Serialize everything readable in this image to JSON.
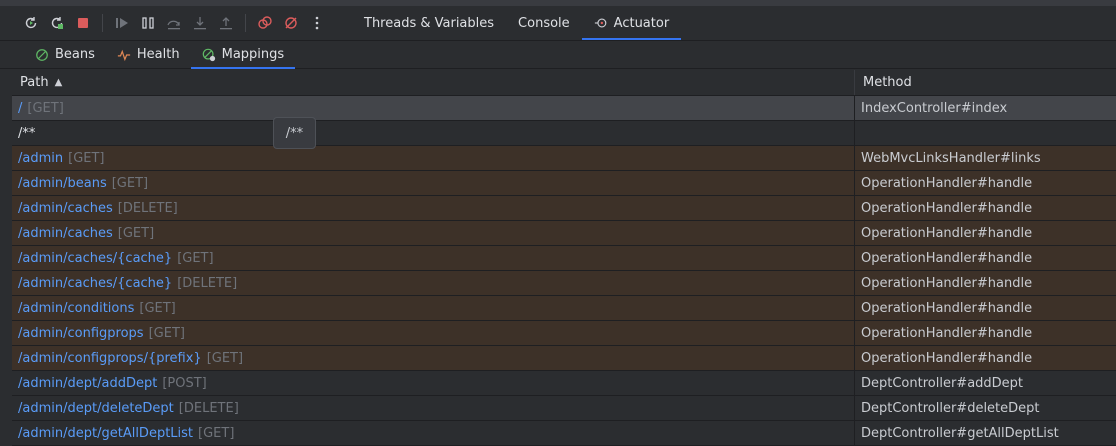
{
  "toolbar": {
    "icons": [
      "rerun-icon",
      "restart-icon",
      "stop-icon",
      "resume-icon",
      "pause-icon",
      "step-over-icon",
      "step-into-icon",
      "step-out-icon",
      "view-breakpoints-icon",
      "mute-breakpoints-icon",
      "more-icon"
    ],
    "tabs": [
      {
        "label": "Threads & Variables"
      },
      {
        "label": "Console"
      },
      {
        "label": "Actuator"
      }
    ]
  },
  "subtabs": [
    {
      "label": "Beans"
    },
    {
      "label": "Health"
    },
    {
      "label": "Mappings"
    }
  ],
  "table": {
    "headers": {
      "path": "Path",
      "method": "Method"
    },
    "rows": [
      {
        "url": "/",
        "verb": "[GET]",
        "method": "IndexController#index",
        "style": "sel"
      },
      {
        "url": "/**",
        "verb": "",
        "method": "",
        "style": "plain"
      },
      {
        "url": "/admin",
        "verb": "[GET]",
        "method": "WebMvcLinksHandler#links",
        "style": "brown"
      },
      {
        "url": "/admin/beans",
        "verb": "[GET]",
        "method": "OperationHandler#handle",
        "style": "brown"
      },
      {
        "url": "/admin/caches",
        "verb": "[DELETE]",
        "method": "OperationHandler#handle",
        "style": "brown"
      },
      {
        "url": "/admin/caches",
        "verb": "[GET]",
        "method": "OperationHandler#handle",
        "style": "brown"
      },
      {
        "url": "/admin/caches/{cache}",
        "verb": "[GET]",
        "method": "OperationHandler#handle",
        "style": "brown"
      },
      {
        "url": "/admin/caches/{cache}",
        "verb": "[DELETE]",
        "method": "OperationHandler#handle",
        "style": "brown"
      },
      {
        "url": "/admin/conditions",
        "verb": "[GET]",
        "method": "OperationHandler#handle",
        "style": "brown"
      },
      {
        "url": "/admin/configprops",
        "verb": "[GET]",
        "method": "OperationHandler#handle",
        "style": "brown"
      },
      {
        "url": "/admin/configprops/{prefix}",
        "verb": "[GET]",
        "method": "OperationHandler#handle",
        "style": "brown"
      },
      {
        "url": "/admin/dept/addDept",
        "verb": "[POST]",
        "method": "DeptController#addDept",
        "style": "dark"
      },
      {
        "url": "/admin/dept/deleteDept",
        "verb": "[DELETE]",
        "method": "DeptController#deleteDept",
        "style": "dark"
      },
      {
        "url": "/admin/dept/getAllDeptList",
        "verb": "[GET]",
        "method": "DeptController#getAllDeptList",
        "style": "dark"
      }
    ]
  },
  "tooltip": {
    "text": "/**"
  },
  "colors": {
    "accent": "#3574f0",
    "link": "#5a9cf8",
    "highlight_row": "#3d3128"
  }
}
